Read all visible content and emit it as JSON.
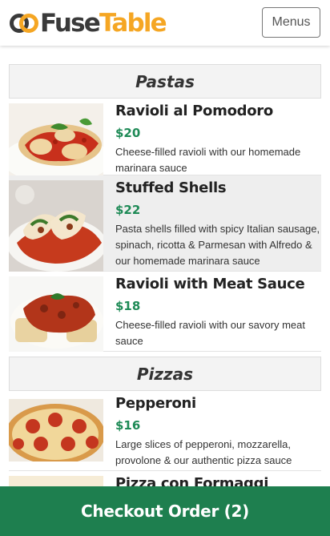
{
  "header": {
    "logo": {
      "part1": "Fuse",
      "part2": "Table"
    },
    "menus_label": "Menus"
  },
  "sections": [
    {
      "title": "Pastas",
      "items": [
        {
          "name": "Ravioli al Pomodoro",
          "price": "$20",
          "desc": "Cheese-filled ravioli with our homemade marinara sauce"
        },
        {
          "name": "Stuffed Shells",
          "price": "$22",
          "desc": "Pasta shells filled with spicy Italian sausage, spinach, ricotta & Parmesan with Alfredo & our homemade marinara sauce"
        },
        {
          "name": "Ravioli with Meat Sauce",
          "price": "$18",
          "desc": "Cheese-filled ravioli with our savory meat sauce"
        }
      ]
    },
    {
      "title": "Pizzas",
      "items": [
        {
          "name": "Pepperoni",
          "price": "$16",
          "desc": "Large slices of pepperoni, mozzarella, provolone & our authentic pizza sauce"
        },
        {
          "name": "Pizza con Formaggi",
          "price": "",
          "desc": ""
        }
      ]
    }
  ],
  "checkout": {
    "label": "Checkout Order (2)"
  },
  "colors": {
    "brand_orange": "#f5a623",
    "price_green": "#1e8a56",
    "checkout_green": "#1e7f4f"
  }
}
